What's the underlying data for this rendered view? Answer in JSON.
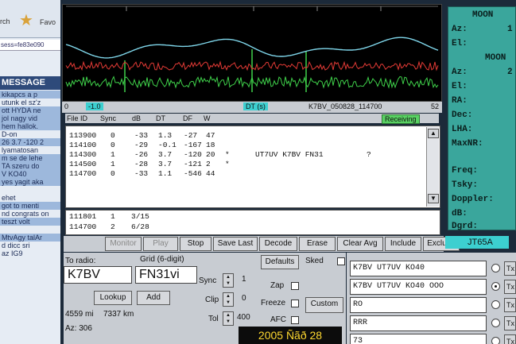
{
  "browser": {
    "toolbar_left": "rch",
    "favorites": "Favo",
    "address": "sess=fe83e090",
    "message_header": "MESSAGE",
    "lines": [
      {
        "text": "kikapcs a p",
        "hl": true
      },
      {
        "text": "utunk el sz'z",
        "hl": false
      },
      {
        "text": "ott HYDA ne",
        "hl": true
      },
      {
        "text": "jol nagy vid",
        "hl": true
      },
      {
        "text": "hem hallok.",
        "hl": true
      },
      {
        "text": "D-on",
        "hl": false
      },
      {
        "text": "26 3.7 -120 2",
        "hl": true
      },
      {
        "text": "lyamatosan",
        "hl": false
      },
      {
        "text": "m se de lehe",
        "hl": true
      },
      {
        "text": "TA szeru do",
        "hl": true
      },
      {
        "text": "V KO40",
        "hl": true
      },
      {
        "text": "yes yagit aka",
        "hl": true
      },
      {
        "text": "",
        "hl": false
      },
      {
        "text": "ehet",
        "hl": false
      },
      {
        "text": "got to menti",
        "hl": true
      },
      {
        "text": "nd congrats on",
        "hl": false
      },
      {
        "text": "teszt volt",
        "hl": true
      },
      {
        "text": "",
        "hl": false
      },
      {
        "text": "MtvAgy talAr",
        "hl": true
      },
      {
        "text": "d dicc sri",
        "hl": false
      },
      {
        "text": "az IG9",
        "hl": false
      }
    ]
  },
  "spectrum": {
    "axis_start": "0",
    "axis_end": "52",
    "marker": "-1.0",
    "dt_label": "DT (s)",
    "filename": "K7BV_050828_114700"
  },
  "table": {
    "receiving": "Receiving",
    "headers": [
      "File ID",
      "Sync",
      "dB",
      "DT",
      "DF",
      "W"
    ],
    "rows": [
      {
        "id": "113900",
        "sync": "0",
        "db": "-33",
        "dt": "1.3",
        "df": "-27",
        "w": "47",
        "mark": "",
        "msg": "",
        "q": ""
      },
      {
        "id": "114100",
        "sync": "0",
        "db": "-29",
        "dt": "-0.1",
        "df": "-167",
        "w": "18",
        "mark": "",
        "msg": "",
        "q": ""
      },
      {
        "id": "114300",
        "sync": "1",
        "db": "-26",
        "dt": "3.7",
        "df": "-120",
        "w": "20",
        "mark": "*",
        "msg": "UT7UV K7BV FN31",
        "q": "?"
      },
      {
        "id": "114500",
        "sync": "1",
        "db": "-28",
        "dt": "3.7",
        "df": "-121",
        "w": "2",
        "mark": "*",
        "msg": "",
        "q": ""
      },
      {
        "id": "114700",
        "sync": "0",
        "db": "-33",
        "dt": "1.1",
        "df": "-546",
        "w": "44",
        "mark": "",
        "msg": "",
        "q": ""
      }
    ],
    "avg_rows": [
      {
        "id": "111801",
        "sync": "1",
        "frac": "3/15"
      },
      {
        "id": "114700",
        "sync": "2",
        "frac": "6/28"
      }
    ]
  },
  "buttons": {
    "monitor": "Monitor",
    "play": "Play",
    "stop": "Stop",
    "save_last": "Save Last",
    "decode": "Decode",
    "erase": "Erase",
    "clear_avg": "Clear Avg",
    "include": "Include",
    "exclude": "Exclude"
  },
  "mode": "JT65A",
  "controls": {
    "to_radio_label": "To radio:",
    "to_radio_value": "K7BV",
    "grid_label": "Grid (6-digit)",
    "grid_value": "FN31vi",
    "lookup": "Lookup",
    "add": "Add",
    "distance_mi": "4559 mi",
    "distance_km": "7337 km",
    "azimuth": "Az: 306",
    "sync_label": "Sync",
    "sync_value": "1",
    "clip_label": "Clip",
    "clip_value": "0",
    "tol_label": "Tol",
    "tol_value": "400",
    "defaults": "Defaults",
    "sked": "Sked",
    "zap": "Zap",
    "freeze": "Freeze",
    "afc": "AFC",
    "custom": "Custom"
  },
  "date": "2005 Ñãð 28",
  "messages": [
    {
      "text": "K7BV UT7UV KO40",
      "selected": false
    },
    {
      "text": "K7BV UT7UV KO40 OOO",
      "selected": true
    },
    {
      "text": "RO",
      "selected": false
    },
    {
      "text": "RRR",
      "selected": false
    },
    {
      "text": "73",
      "selected": false
    }
  ],
  "tx_label": "Tx",
  "astro": {
    "moon1": "MOON",
    "moon2": "MOON",
    "az1": "Az:",
    "el1": "El:",
    "az2": "Az:",
    "el2": "El:",
    "ra": "RA:",
    "dec": "Dec:",
    "lha": "LHA:",
    "maxnr": "MaxNR:",
    "freq": "Freq:",
    "tsky": "Tsky:",
    "doppler": "Doppler:",
    "db": "dB:",
    "dgrd": "Dgrd:",
    "az1_val": "1",
    "az2_val": "2"
  },
  "colors": {
    "panel": "#c8ccd2",
    "cyan": "#3ccfd0",
    "astro": "#3aa69c",
    "receiving": "#59d163",
    "spectrum_cyan": "#7fd6ea",
    "spectrum_red": "#e23a35",
    "spectrum_green": "#3fd14a"
  }
}
